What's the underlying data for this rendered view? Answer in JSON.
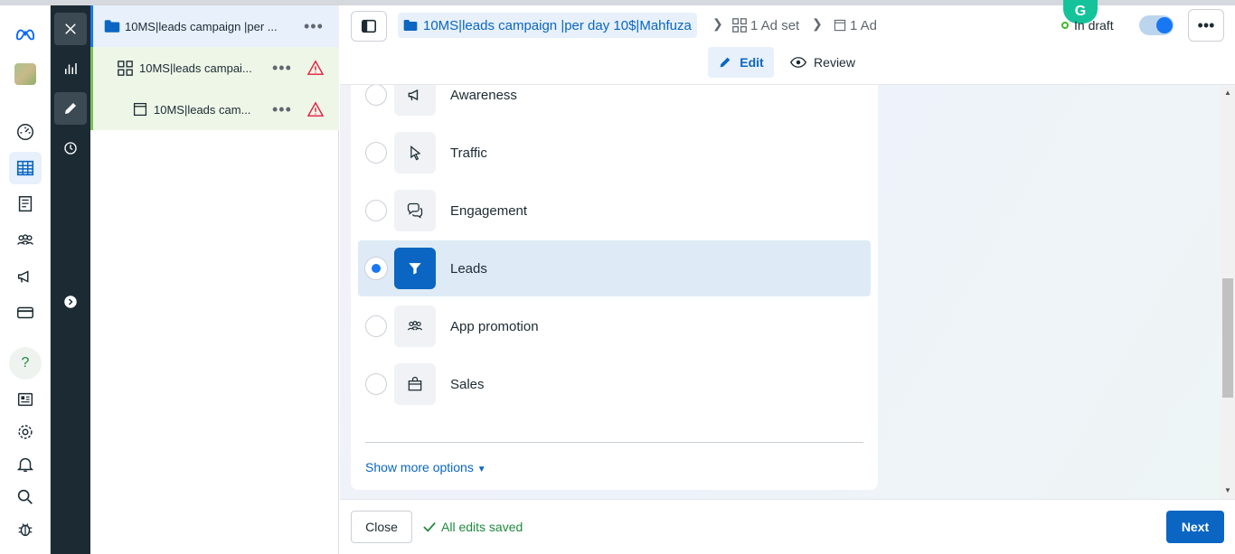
{
  "tree": {
    "campaign": "10MS|leads campaign |per ...",
    "adset": "10MS|leads campai...",
    "ad": "10MS|leads cam...",
    "more": "•••"
  },
  "header": {
    "campaign_crumb": "10MS|leads campaign |per day 10$|Mahfuza",
    "adset_crumb": "1 Ad set",
    "ad_crumb": "1 Ad",
    "status": "In draft",
    "more": "•••",
    "edit_tab": "Edit",
    "review_tab": "Review",
    "grammarly": "G"
  },
  "objectives": [
    {
      "label": "Awareness",
      "icon": "megaphone-icon",
      "selected": false
    },
    {
      "label": "Traffic",
      "icon": "cursor-icon",
      "selected": false
    },
    {
      "label": "Engagement",
      "icon": "chat-bubbles-icon",
      "selected": false
    },
    {
      "label": "Leads",
      "icon": "funnel-icon",
      "selected": true
    },
    {
      "label": "App promotion",
      "icon": "people-icon",
      "selected": false
    },
    {
      "label": "Sales",
      "icon": "shopping-bag-icon",
      "selected": false
    }
  ],
  "show_more": "Show more options",
  "footer": {
    "close": "Close",
    "saved": "All edits saved",
    "next": "Next"
  },
  "colors": {
    "accent": "#0a66c2",
    "selected_bg": "#deebf7",
    "dark_rail": "#1c2b33",
    "success": "#1f8a3e",
    "warning": "#e41e3f"
  }
}
